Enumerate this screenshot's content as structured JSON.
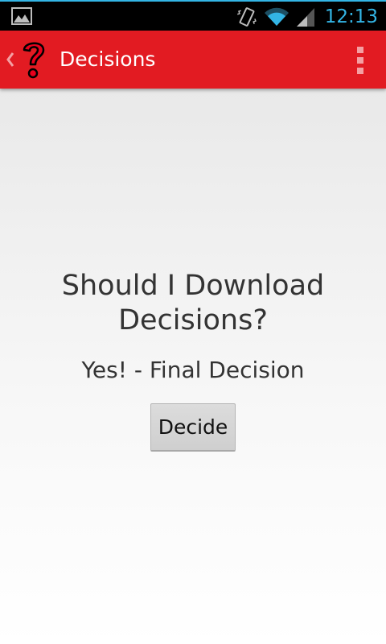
{
  "status_bar": {
    "time": "12:13",
    "icons": [
      "gallery-icon",
      "vibrate-icon",
      "wifi-icon",
      "signal-icon"
    ],
    "accent_color": "#33b5e5"
  },
  "action_bar": {
    "title": "Decisions",
    "background_color": "#e21b22",
    "icons": [
      "up-chevron-icon",
      "question-mark-icon",
      "overflow-menu-icon"
    ]
  },
  "main": {
    "question": "Should I Download Decisions?",
    "decision": "Yes! - Final Decision",
    "decide_label": "Decide"
  }
}
